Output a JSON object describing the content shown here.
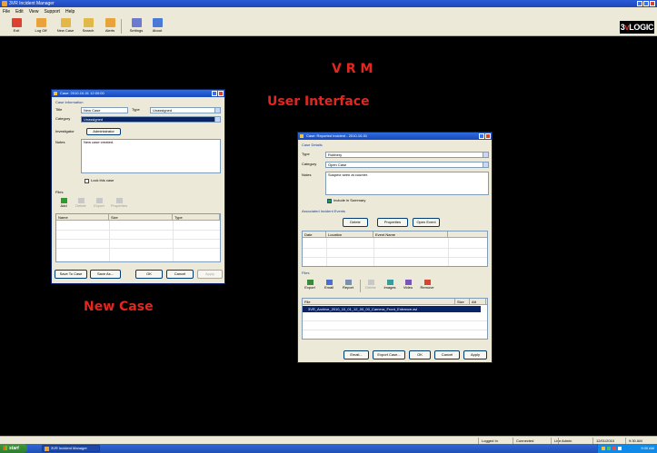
{
  "window": {
    "title": "3VR Incident Manager"
  },
  "menu": [
    "File",
    "Edit",
    "View",
    "Support",
    "Help"
  ],
  "toolbar": [
    {
      "label": "Exit",
      "icon": "exit-icon",
      "color": "#d9432f"
    },
    {
      "label": "Log Off",
      "icon": "logoff-icon",
      "color": "#e8a33a"
    },
    {
      "label": "New Case",
      "icon": "new-case-icon",
      "color": "#e2b84a"
    },
    {
      "label": "Search",
      "icon": "search-icon",
      "color": "#e2b84a"
    },
    {
      "label": "Alerts",
      "icon": "alerts-icon",
      "color": "#e8a33a"
    },
    {
      "label": "Settings",
      "icon": "settings-icon",
      "color": "#6b7bd1"
    },
    {
      "label": "About",
      "icon": "about-icon",
      "color": "#4a7ad6"
    }
  ],
  "logo": {
    "prefix": "3",
    "accent": "v",
    "suffix": "LOGIC"
  },
  "headline": {
    "line1": "V R M",
    "line2": "User Interface"
  },
  "caption_new_case": "New Case",
  "new_case_dialog": {
    "title": "Case: 2010-10-01 12:00:00",
    "section": "Case Information",
    "fields": [
      {
        "label": "Title",
        "value": "New Case"
      },
      {
        "label": "Type",
        "value": "Unassigned"
      },
      {
        "label": "Category",
        "value": "Unassigned"
      },
      {
        "label": "Investigator",
        "value": "Administrator"
      }
    ],
    "notes_label": "Notes",
    "notes_value": "New case created.",
    "checkbox_label": "Lock this case",
    "attachments_label": "Files",
    "actions": [
      "Add",
      "Delete",
      "Export",
      "Properties"
    ],
    "grid_headers": [
      "Name",
      "Size",
      "Type"
    ],
    "buttons": [
      "Save To Case",
      "Save As...",
      "OK",
      "Cancel",
      "Apply"
    ]
  },
  "case_dialog": {
    "title": "Case: Reported Incident - 2010-10-01",
    "section": "Case Details",
    "fields": [
      {
        "label": "Type",
        "value": "Robbery"
      },
      {
        "label": "Category",
        "value": "Open Case"
      }
    ],
    "notes_label": "Notes",
    "notes_value": "Suspect seen at counter.",
    "checkbox_label": "Include in Summary",
    "related_label": "Associated Incident Events",
    "related_buttons": [
      "Delete",
      "Properties",
      "Open Event"
    ],
    "related_headers": [
      "Date",
      "Location",
      "Event Name"
    ],
    "files_label": "Files",
    "file_actions": [
      "Export",
      "Email",
      "Report",
      "Delete",
      "Images",
      "Video",
      "Remove"
    ],
    "file_headers": [
      "File",
      "Size",
      "Att"
    ],
    "file_row": "3VR_Archive_2010_10_01_12_00_00_Camera_Front_Entrance.avi",
    "buttons": [
      "Email...",
      "Export Case...",
      "OK",
      "Cancel",
      "Apply"
    ]
  },
  "status": {
    "items": [
      "Logged In",
      "Connected",
      "Live",
      "Admin",
      "12/01/2010",
      "9:30 AM"
    ]
  },
  "taskbar": {
    "start": "start",
    "task": "3VR Incident Manager",
    "clock": "9:30 AM"
  }
}
